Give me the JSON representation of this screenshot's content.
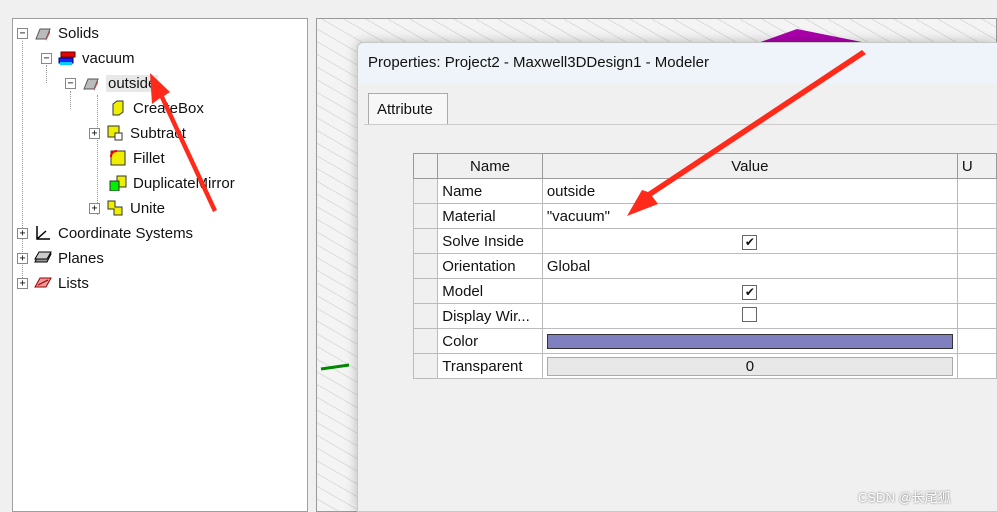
{
  "tree": {
    "items": [
      {
        "label": "Solids",
        "icon": "solid-box-icon",
        "expander": "minus"
      },
      {
        "label": "vacuum",
        "icon": "material-icon",
        "expander": "minus"
      },
      {
        "label": "outside",
        "icon": "solid-box-icon",
        "expander": "minus"
      },
      {
        "label": "CreateBox",
        "icon": "create-box-icon"
      },
      {
        "label": "Subtract",
        "icon": "subtract-icon",
        "expander": "plus"
      },
      {
        "label": "Fillet",
        "icon": "fillet-icon"
      },
      {
        "label": "DuplicateMirror",
        "icon": "duplicate-mirror-icon"
      },
      {
        "label": "Unite",
        "icon": "unite-icon",
        "expander": "plus"
      },
      {
        "label": "Coordinate Systems",
        "icon": "coordinate-systems-icon",
        "expander": "plus"
      },
      {
        "label": "Planes",
        "icon": "planes-icon",
        "expander": "plus"
      },
      {
        "label": "Lists",
        "icon": "lists-icon",
        "expander": "plus"
      }
    ]
  },
  "dialog": {
    "title": "Properties: Project2 - Maxwell3DDesign1 - Modeler",
    "tab": "Attribute",
    "columns": [
      "Name",
      "Value",
      "U"
    ],
    "rows": [
      {
        "name": "Name",
        "value": "outside"
      },
      {
        "name": "Material",
        "value": "\"vacuum\""
      },
      {
        "name": "Solve Inside",
        "checked": true
      },
      {
        "name": "Orientation",
        "value": "Global"
      },
      {
        "name": "Model",
        "checked": true
      },
      {
        "name": "Display Wir...",
        "checked": false
      },
      {
        "name": "Color",
        "color": "#8080c0"
      },
      {
        "name": "Transparent",
        "value": "0"
      }
    ]
  },
  "annotation_color": "#ff2a1a",
  "watermark": "CSDN @长尾狐"
}
